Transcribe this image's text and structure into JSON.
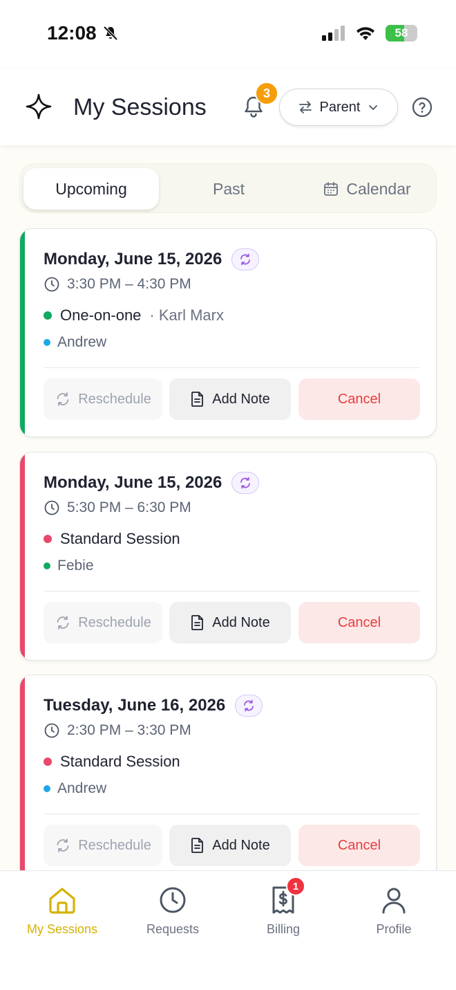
{
  "status_bar": {
    "time": "12:08",
    "battery": "58",
    "battery_level": 0.58
  },
  "header": {
    "title": "My Sessions",
    "notification_count": "3",
    "role_label": "Parent"
  },
  "tabs": [
    {
      "label": "Upcoming",
      "active": true
    },
    {
      "label": "Past",
      "active": false
    },
    {
      "label": "Calendar",
      "active": false
    }
  ],
  "sessions": [
    {
      "date": "Monday, June 15, 2026",
      "time": "3:30 PM – 4:30 PM",
      "type": "One-on-one",
      "tutor": "· Karl Marx",
      "student": "Andrew",
      "accent_color": "#10a960",
      "type_dot_color": "#10a960",
      "student_dot_color": "#1ea7e8"
    },
    {
      "date": "Monday, June 15, 2026",
      "time": "5:30 PM – 6:30 PM",
      "type": "Standard Session",
      "tutor": "",
      "student": "Febie",
      "accent_color": "#e8486a",
      "type_dot_color": "#e8486a",
      "student_dot_color": "#10a960"
    },
    {
      "date": "Tuesday, June 16, 2026",
      "time": "2:30 PM – 3:30 PM",
      "type": "Standard Session",
      "tutor": "",
      "student": "Andrew",
      "accent_color": "#e8486a",
      "type_dot_color": "#e8486a",
      "student_dot_color": "#1ea7e8"
    }
  ],
  "actions": {
    "reschedule": "Reschedule",
    "add_note": "Add Note",
    "cancel": "Cancel"
  },
  "bottom_nav": [
    {
      "label": "My Sessions",
      "icon": "home-icon",
      "active": true
    },
    {
      "label": "Requests",
      "icon": "clock-icon",
      "active": false
    },
    {
      "label": "Billing",
      "icon": "receipt-dollar-icon",
      "active": false,
      "badge": "1"
    },
    {
      "label": "Profile",
      "icon": "user-icon",
      "active": false
    }
  ],
  "colors": {
    "accent_active": "#d4b206",
    "cancel_text": "#e53e3e",
    "badge_orange": "#f59e0b",
    "badge_red": "#ef3340"
  }
}
